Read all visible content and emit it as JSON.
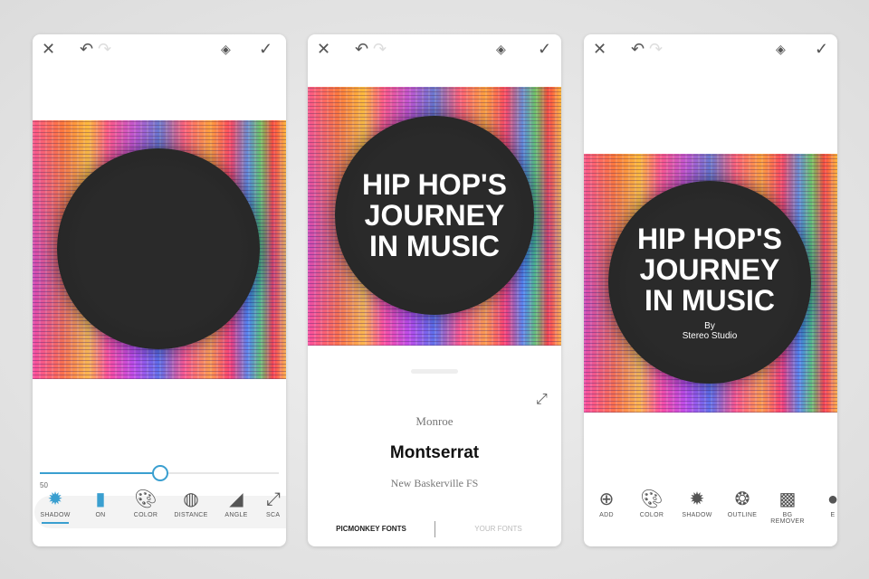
{
  "panels": [
    {
      "icons": [
        "close-icon",
        "undo-icon",
        "redo-icon",
        "layers-icon",
        "check-icon"
      ],
      "slider": {
        "value": 50,
        "label": "50"
      },
      "tools": [
        {
          "label": "SHADOW",
          "icon": "shadow-icon",
          "active": true
        },
        {
          "label": "ON",
          "icon": "toggle-icon"
        },
        {
          "label": "COLOR",
          "icon": "palette-icon"
        },
        {
          "label": "DISTANCE",
          "icon": "distance-icon"
        },
        {
          "label": "ANGLE",
          "icon": "angle-icon"
        },
        {
          "label": "SCA",
          "icon": "scale-icon"
        }
      ]
    },
    {
      "title": [
        "HIP HOP'S",
        "JOURNEY",
        "IN MUSIC"
      ],
      "fonts": [
        "Monroe",
        "Montserrat",
        "New Baskerville FS"
      ],
      "tabs": [
        "PICMONKEY FONTS",
        "YOUR FONTS"
      ]
    },
    {
      "title": [
        "HIP HOP'S",
        "JOURNEY",
        "IN MUSIC"
      ],
      "byline": [
        "By",
        "Stereo Studio"
      ],
      "tools": [
        {
          "label": "ADD",
          "icon": "add-icon"
        },
        {
          "label": "COLOR",
          "icon": "palette-icon"
        },
        {
          "label": "SHADOW",
          "icon": "shadow-icon"
        },
        {
          "label": "OUTLINE",
          "icon": "outline-icon"
        },
        {
          "label": "BG REMOVER",
          "icon": "bg-remover-icon"
        },
        {
          "label": "E",
          "icon": "effects-icon"
        }
      ]
    }
  ],
  "colors": {
    "accent": "#3a9fd0"
  }
}
